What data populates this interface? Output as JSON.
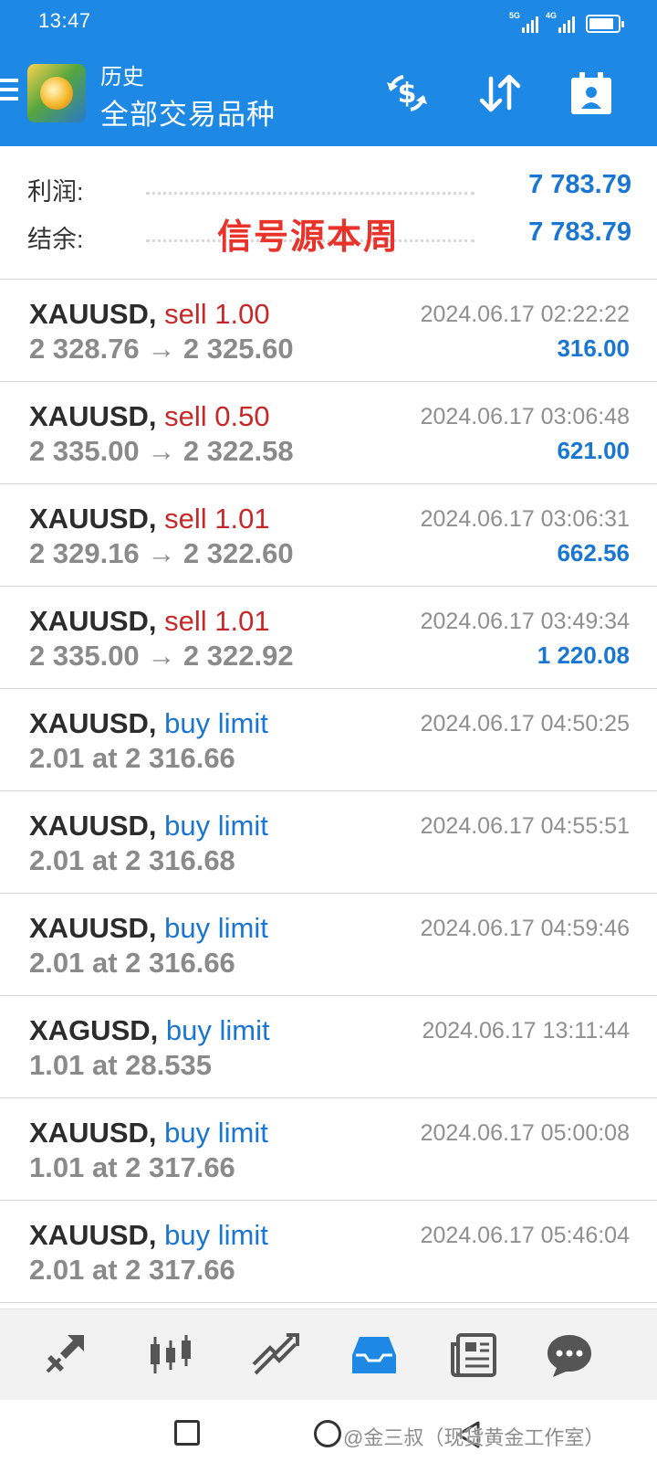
{
  "status_bar": {
    "time": "13:47",
    "sim1_label": "5G",
    "sim2_label": "4G",
    "battery_level": 0.85
  },
  "app_bar": {
    "title": "历史",
    "subtitle": "全部交易品种",
    "icons": [
      "menu-icon",
      "app-logo",
      "currency-swap-icon",
      "sort-icon",
      "calendar-icon"
    ]
  },
  "summary": {
    "profit_label": "利润:",
    "profit_value": "7 783.79",
    "balance_label": "结余:",
    "balance_value": "7 783.79",
    "overlay_text": "信号源本周"
  },
  "trades": [
    {
      "symbol": "XAUUSD",
      "type": "sell 1.00",
      "side": "sell",
      "detail": "2 328.76 → 2 325.60",
      "time": "2024.06.17 02:22:22",
      "profit": "316.00"
    },
    {
      "symbol": "XAUUSD",
      "type": "sell 0.50",
      "side": "sell",
      "detail": "2 335.00 → 2 322.58",
      "time": "2024.06.17 03:06:48",
      "profit": "621.00"
    },
    {
      "symbol": "XAUUSD",
      "type": "sell 1.01",
      "side": "sell",
      "detail": "2 329.16 → 2 322.60",
      "time": "2024.06.17 03:06:31",
      "profit": "662.56"
    },
    {
      "symbol": "XAUUSD",
      "type": "sell 1.01",
      "side": "sell",
      "detail": "2 335.00 → 2 322.92",
      "time": "2024.06.17 03:49:34",
      "profit": "1 220.08"
    },
    {
      "symbol": "XAUUSD",
      "type": "buy limit",
      "side": "buy",
      "detail": "2.01 at 2 316.66",
      "time": "2024.06.17 04:50:25",
      "profit": ""
    },
    {
      "symbol": "XAUUSD",
      "type": "buy limit",
      "side": "buy",
      "detail": "2.01 at 2 316.68",
      "time": "2024.06.17 04:55:51",
      "profit": ""
    },
    {
      "symbol": "XAUUSD",
      "type": "buy limit",
      "side": "buy",
      "detail": "2.01 at 2 316.66",
      "time": "2024.06.17 04:59:46",
      "profit": ""
    },
    {
      "symbol": "XAGUSD",
      "type": "buy limit",
      "side": "buy",
      "detail": "1.01 at 28.535",
      "time": "2024.06.17 13:11:44",
      "profit": ""
    },
    {
      "symbol": "XAUUSD",
      "type": "buy limit",
      "side": "buy",
      "detail": "1.01 at 2 317.66",
      "time": "2024.06.17 05:00:08",
      "profit": ""
    },
    {
      "symbol": "XAUUSD",
      "type": "buy limit",
      "side": "buy",
      "detail": "2.01 at 2 317.66",
      "time": "2024.06.17 05:46:04",
      "profit": ""
    }
  ],
  "tab_bar": {
    "tabs": [
      "quotes-icon",
      "chart-icon",
      "trade-icon",
      "history-icon",
      "news-icon",
      "chat-icon"
    ],
    "active": "history-icon",
    "active_color": "#1E88E5"
  },
  "nav_bar": {
    "watermark": "@金三叔（现货黄金工作室）"
  },
  "colors": {
    "primary": "#1E88E5",
    "sell": "#c62828",
    "buy": "#1976D2",
    "overlay": "#e8322a"
  }
}
